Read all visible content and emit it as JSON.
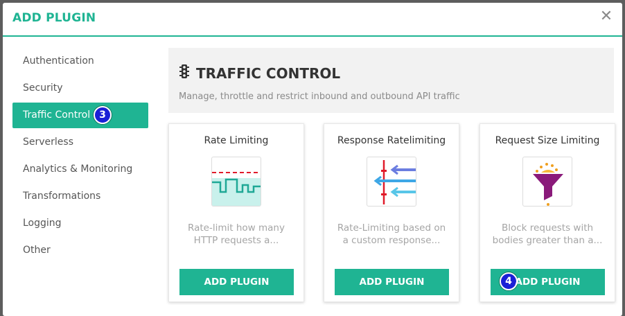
{
  "modal": {
    "title": "ADD PLUGIN",
    "close_glyph": "✕"
  },
  "sidebar": {
    "items": [
      {
        "label": "Authentication",
        "active": false
      },
      {
        "label": "Security",
        "active": false
      },
      {
        "label": "Traffic Control",
        "active": true,
        "badge": "3"
      },
      {
        "label": "Serverless",
        "active": false
      },
      {
        "label": "Analytics & Monitoring",
        "active": false
      },
      {
        "label": "Transformations",
        "active": false
      },
      {
        "label": "Logging",
        "active": false
      },
      {
        "label": "Other",
        "active": false
      }
    ]
  },
  "section": {
    "icon": "traffic-light-icon",
    "title": "TRAFFIC CONTROL",
    "description": "Manage, throttle and restrict inbound and outbound API traffic"
  },
  "plugins": [
    {
      "title": "Rate Limiting",
      "icon": "rate-limiting-icon",
      "description": "Rate-limit how many HTTP requests a...",
      "button": "ADD PLUGIN"
    },
    {
      "title": "Response Ratelimiting",
      "icon": "response-ratelimiting-icon",
      "description": "Rate-Limiting based on a custom response...",
      "button": "ADD PLUGIN"
    },
    {
      "title": "Request Size Limiting",
      "icon": "funnel-icon",
      "description": "Block requests with bodies greater than a...",
      "button": "ADD PLUGIN",
      "badge": "4"
    }
  ],
  "colors": {
    "accent": "#1fb493",
    "badge": "#1a1fd6",
    "overlay": "#5d5d5d"
  }
}
